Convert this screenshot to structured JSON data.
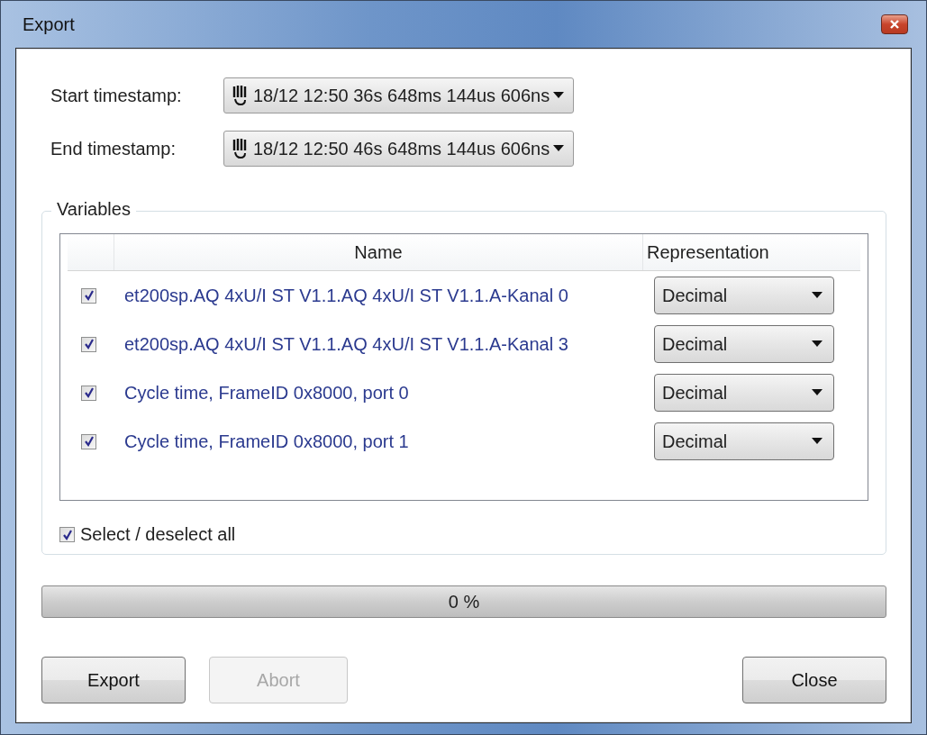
{
  "window": {
    "title": "Export"
  },
  "start": {
    "label": "Start timestamp:",
    "value": "18/12 12:50 36s 648ms 144us 606ns"
  },
  "end": {
    "label": "End timestamp:",
    "value": "18/12 12:50 46s 648ms 144us 606ns"
  },
  "variables": {
    "title": "Variables",
    "columns": [
      "Name",
      "Representation"
    ],
    "rows": [
      {
        "checked": true,
        "name": "et200sp.AQ 4xU/I ST V1.1.AQ 4xU/I ST V1.1.A-Kanal 0",
        "representation": "Decimal"
      },
      {
        "checked": true,
        "name": "et200sp.AQ 4xU/I ST V1.1.AQ 4xU/I ST V1.1.A-Kanal 3",
        "representation": "Decimal"
      },
      {
        "checked": true,
        "name": "Cycle time, FrameID 0x8000, port 0",
        "representation": "Decimal"
      },
      {
        "checked": true,
        "name": "Cycle time, FrameID 0x8000, port 1",
        "representation": "Decimal"
      }
    ],
    "select_all": {
      "label": "Select / deselect all",
      "checked": true
    }
  },
  "progress": {
    "level": 0,
    "label": "0 %"
  },
  "buttons": [
    {
      "label": "Export",
      "disabled": false
    },
    {
      "label": "Abort",
      "disabled": true
    },
    {
      "label": "Close",
      "disabled": false
    }
  ]
}
